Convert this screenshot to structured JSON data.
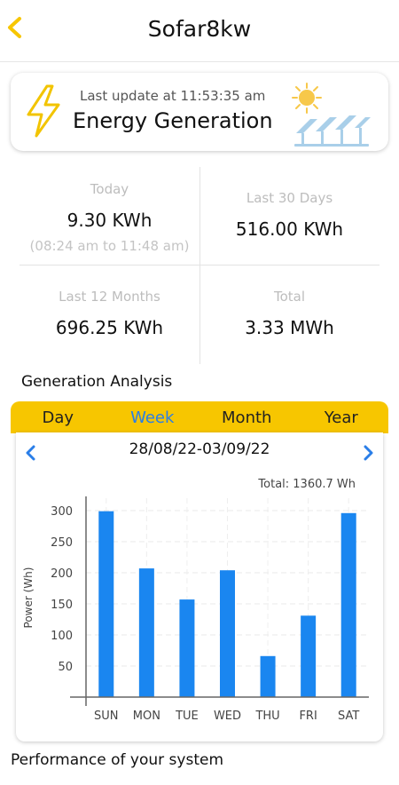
{
  "header": {
    "title": "Sofar8kw",
    "back_icon": "chevron-left-icon"
  },
  "banner": {
    "last_update": "Last update at 11:53:35 am",
    "title": "Energy Generation",
    "bolt_icon": "lightning-bolt-icon",
    "illustration": "sun-solar-panels-icon"
  },
  "stats": {
    "today": {
      "label": "Today",
      "value": "9.30  KWh",
      "range": "(08:24 am to 11:48 am)"
    },
    "last30": {
      "label": "Last 30 Days",
      "value": "516.00  KWh"
    },
    "last12": {
      "label": "Last 12 Months",
      "value": "696.25  KWh"
    },
    "total": {
      "label": "Total",
      "value": "3.33  MWh"
    }
  },
  "analysis": {
    "title": "Generation Analysis",
    "tabs": [
      "Day",
      "Week",
      "Month",
      "Year"
    ],
    "active_tab": "Week",
    "date_range": "28/08/22-03/09/22",
    "total": "Total: 1360.7 Wh"
  },
  "chart_data": {
    "type": "bar",
    "categories": [
      "SUN",
      "MON",
      "TUE",
      "WED",
      "THU",
      "FRI",
      "SAT"
    ],
    "values": [
      299,
      207,
      157,
      204,
      66,
      131,
      296
    ],
    "ylabel": "Power (Wh)",
    "yticks": [
      50,
      100,
      150,
      200,
      250,
      300
    ],
    "ylim": [
      0,
      320
    ],
    "grid": true,
    "bar_color": "#1a86f0"
  },
  "performance": {
    "title": "Performance of your system"
  },
  "colors": {
    "accent": "#f7c600",
    "active_tab": "#2a7ee8",
    "bar": "#1a86f0"
  }
}
